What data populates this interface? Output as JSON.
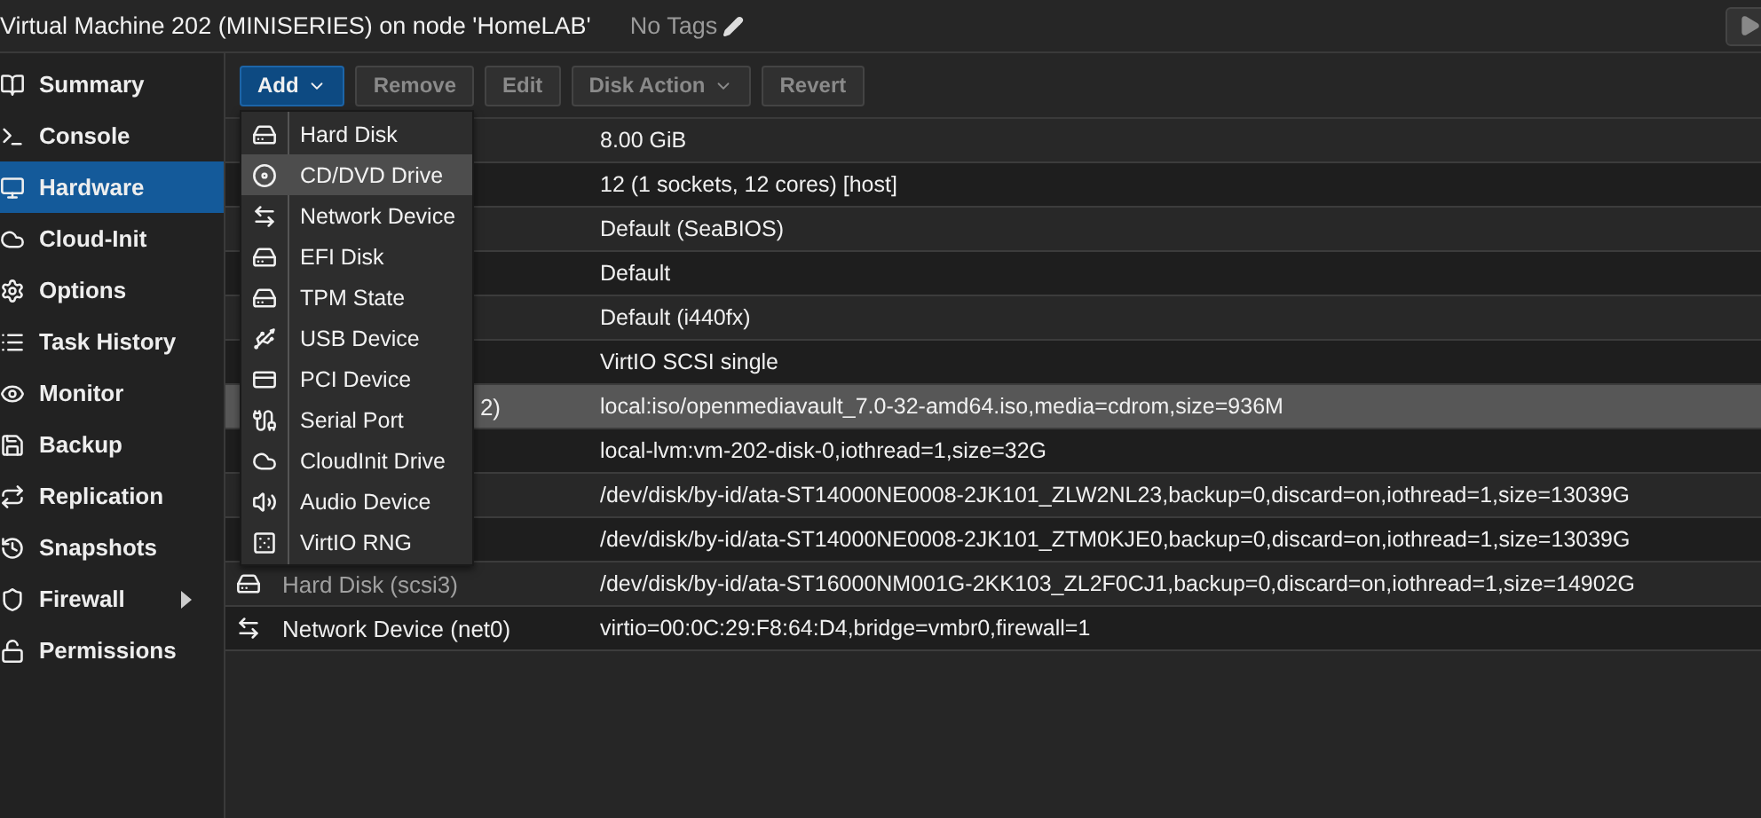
{
  "header": {
    "title": "Virtual Machine 202 (MINISERIES) on node 'HomeLAB'",
    "tags": "No Tags"
  },
  "sidebar": [
    {
      "label": "Summary",
      "selected": false,
      "arrow": false
    },
    {
      "label": "Console",
      "selected": false,
      "arrow": false
    },
    {
      "label": "Hardware",
      "selected": true,
      "arrow": false
    },
    {
      "label": "Cloud-Init",
      "selected": false,
      "arrow": false
    },
    {
      "label": "Options",
      "selected": false,
      "arrow": false
    },
    {
      "label": "Task History",
      "selected": false,
      "arrow": false
    },
    {
      "label": "Monitor",
      "selected": false,
      "arrow": false
    },
    {
      "label": "Backup",
      "selected": false,
      "arrow": false
    },
    {
      "label": "Replication",
      "selected": false,
      "arrow": false
    },
    {
      "label": "Snapshots",
      "selected": false,
      "arrow": false
    },
    {
      "label": "Firewall",
      "selected": false,
      "arrow": true
    },
    {
      "label": "Permissions",
      "selected": false,
      "arrow": false
    }
  ],
  "toolbar": [
    {
      "label": "Add",
      "dropdown": true,
      "disabled": false,
      "primary": true
    },
    {
      "label": "Remove",
      "dropdown": false,
      "disabled": true,
      "primary": false
    },
    {
      "label": "Edit",
      "dropdown": false,
      "disabled": true,
      "primary": false
    },
    {
      "label": "Disk Action",
      "dropdown": true,
      "disabled": true,
      "primary": false
    },
    {
      "label": "Revert",
      "dropdown": false,
      "disabled": true,
      "primary": false
    }
  ],
  "rows": [
    {
      "kind": "covered",
      "value": "8.00 GiB",
      "selected": false
    },
    {
      "kind": "covered",
      "value": "12 (1 sockets, 12 cores) [host]",
      "selected": false
    },
    {
      "kind": "covered",
      "value": "Default (SeaBIOS)",
      "selected": false
    },
    {
      "kind": "covered",
      "value": "Default",
      "selected": false
    },
    {
      "kind": "covered",
      "value": "Default (i440fx)",
      "selected": false
    },
    {
      "kind": "covered",
      "value": "VirtIO SCSI single",
      "selected": false
    },
    {
      "kind": "tail",
      "label": "2)",
      "value": "local:iso/openmediavault_7.0-32-amd64.iso,media=cdrom,size=936M",
      "selected": true
    },
    {
      "kind": "covered",
      "value": "local-lvm:vm-202-disk-0,iothread=1,size=32G",
      "selected": false
    },
    {
      "kind": "covered",
      "value": "/dev/disk/by-id/ata-ST14000NE0008-2JK101_ZLW2NL23,backup=0,discard=on,iothread=1,size=13039G",
      "selected": false
    },
    {
      "kind": "covered",
      "value": "/dev/disk/by-id/ata-ST14000NE0008-2JK101_ZTM0KJE0,backup=0,discard=on,iothread=1,size=13039G",
      "selected": false
    },
    {
      "kind": "disk",
      "label": "Hard Disk (scsi3)",
      "value": "/dev/disk/by-id/ata-ST16000NM001G-2KK103_ZL2F0CJ1,backup=0,discard=on,iothread=1,size=14902G",
      "selected": false
    },
    {
      "kind": "network",
      "label": "Network Device (net0)",
      "value": "virtio=00:0C:29:F8:64:D4,bridge=vmbr0,firewall=1",
      "selected": false
    }
  ],
  "add_menu": [
    {
      "label": "Hard Disk",
      "selected": false
    },
    {
      "label": "CD/DVD Drive",
      "selected": true
    },
    {
      "label": "Network Device",
      "selected": false
    },
    {
      "label": "EFI Disk",
      "selected": false
    },
    {
      "label": "TPM State",
      "selected": false
    },
    {
      "label": "USB Device",
      "selected": false
    },
    {
      "label": "PCI Device",
      "selected": false
    },
    {
      "label": "Serial Port",
      "selected": false
    },
    {
      "label": "CloudInit Drive",
      "selected": false
    },
    {
      "label": "Audio Device",
      "selected": false
    },
    {
      "label": "VirtIO RNG",
      "selected": false
    }
  ]
}
